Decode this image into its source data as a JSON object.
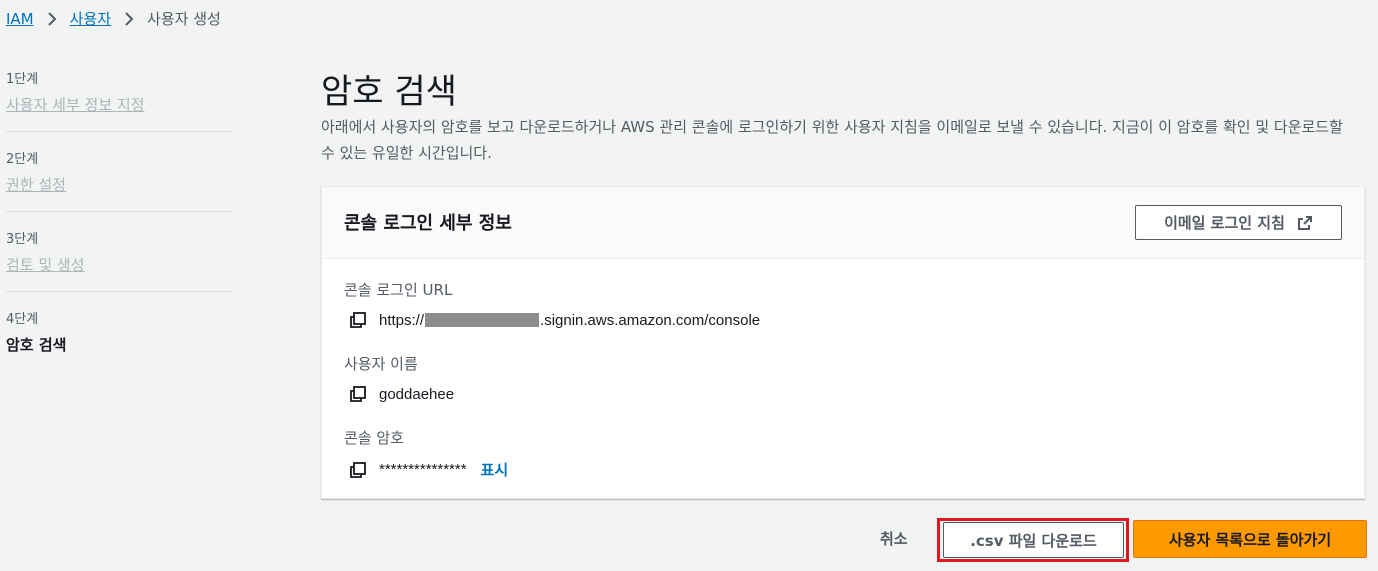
{
  "breadcrumb": {
    "items": [
      "IAM",
      "사용자",
      "사용자 생성"
    ]
  },
  "steps": [
    {
      "num": "1단계",
      "label": "사용자 세부 정보 지정"
    },
    {
      "num": "2단계",
      "label": "권한 설정"
    },
    {
      "num": "3단계",
      "label": "검토 및 생성"
    },
    {
      "num": "4단계",
      "label": "암호 검색"
    }
  ],
  "page": {
    "title": "암호 검색",
    "description": "아래에서 사용자의 암호를 보고 다운로드하거나 AWS 관리 콘솔에 로그인하기 위한 사용자 지침을 이메일로 보낼 수 있습니다. 지금이 이 암호를 확인 및 다운로드할 수 있는 유일한 시간입니다."
  },
  "panel": {
    "title": "콘솔 로그인 세부 정보",
    "email_button": "이메일 로그인 지침",
    "fields": {
      "url_label": "콘솔 로그인 URL",
      "url_prefix": "https://",
      "url_suffix": ".signin.aws.amazon.com/console",
      "username_label": "사용자 이름",
      "username_value": "goddaehee",
      "password_label": "콘솔 암호",
      "password_value": "***************",
      "show_link": "표시"
    }
  },
  "footer": {
    "cancel": "취소",
    "csv_download": ".csv 파일 다운로드",
    "return_button": "사용자 목록으로 돌아가기"
  },
  "colors": {
    "link": "#0073bb",
    "primary": "#ff9900",
    "highlight": "#e3161f"
  }
}
